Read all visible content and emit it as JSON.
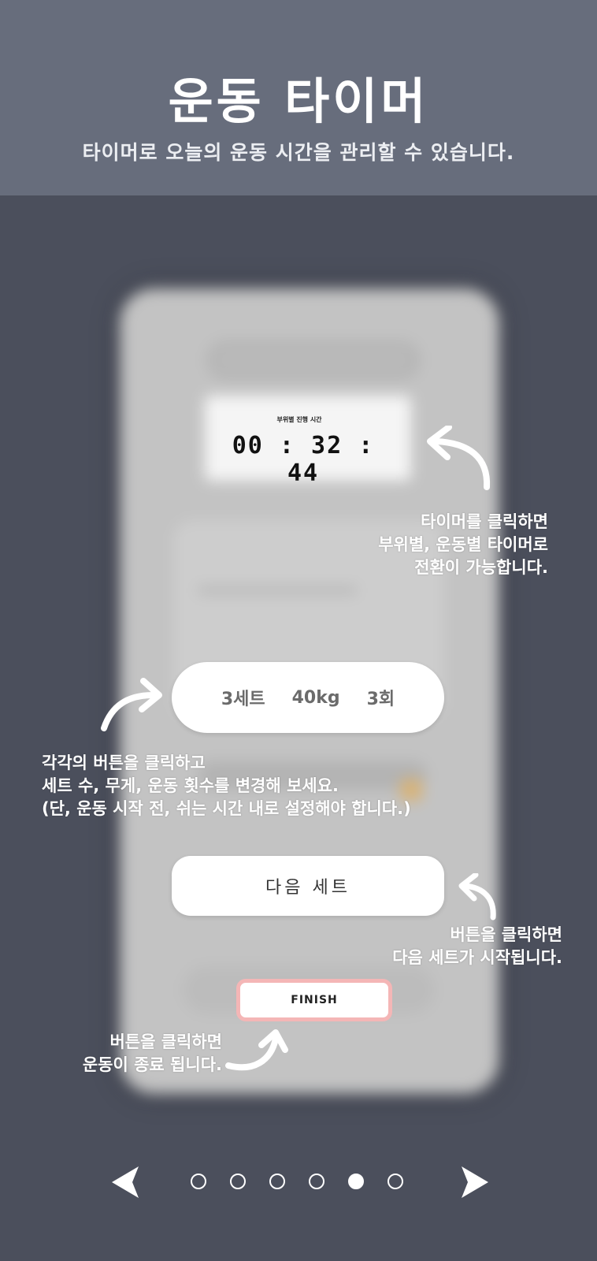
{
  "header": {
    "title": "운동 타이머",
    "subtitle": "타이머로 오늘의 운동 시간을 관리할 수 있습니다."
  },
  "timer": {
    "caption": "부위별 진행 시간",
    "value": "00 : 32 : 44"
  },
  "set_info": {
    "sets": "3세트",
    "weight": "40kg",
    "reps": "3회"
  },
  "next_set_label": "다음 세트",
  "finish_label": "FINISH",
  "annotations": {
    "timer": [
      "타이머를 클릭하면",
      "부위별, 운동별 타이머로",
      "전환이 가능합니다."
    ],
    "set": [
      "각각의 버튼을 클릭하고",
      "세트 수, 무게, 운동 횟수를 변경해 보세요.",
      "(단, 운동 시작 전, 쉬는 시간 내로 설정해야 합니다.)"
    ],
    "next": [
      "버튼을 클릭하면",
      "다음 세트가 시작됩니다."
    ],
    "finish": [
      "버튼을 클릭하면",
      "운동이 종료 됩니다."
    ]
  },
  "pagination": {
    "total": 6,
    "current": 5
  },
  "colors": {
    "background": "#4b4f5c",
    "header": "#676d7c",
    "finish_border": "#f4b6b6"
  },
  "icons": {
    "prev": "chevron-left-icon",
    "next": "chevron-right-icon"
  }
}
